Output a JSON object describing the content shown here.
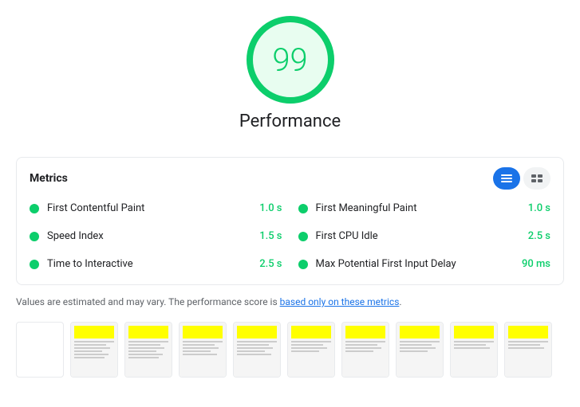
{
  "score": {
    "value": "99",
    "label": "Performance"
  },
  "metrics": {
    "title": "Metrics",
    "items_left": [
      {
        "name": "First Contentful Paint",
        "value": "1.0 s"
      },
      {
        "name": "Speed Index",
        "value": "1.5 s"
      },
      {
        "name": "Time to Interactive",
        "value": "2.5 s"
      }
    ],
    "items_right": [
      {
        "name": "First Meaningful Paint",
        "value": "1.0 s"
      },
      {
        "name": "First CPU Idle",
        "value": "2.5 s"
      },
      {
        "name": "Max Potential First Input Delay",
        "value": "90 ms"
      }
    ]
  },
  "disclaimer": {
    "text_before": "Values are estimated and may vary. The performance score is ",
    "link_text": "based only on these metrics",
    "text_after": "."
  },
  "toggle": {
    "list_label": "List view",
    "grid_label": "Grid view"
  }
}
